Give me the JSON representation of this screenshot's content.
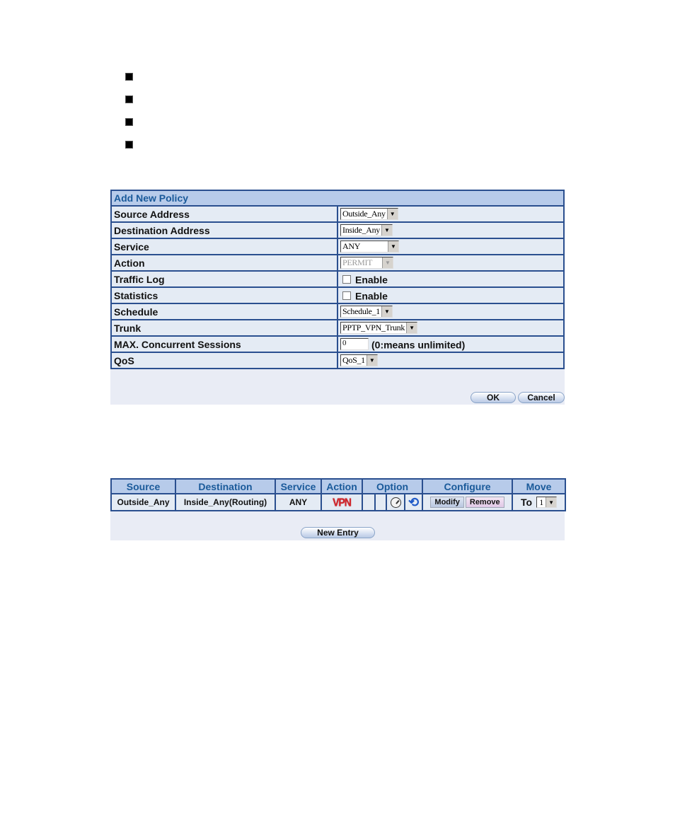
{
  "bullets": {
    "count": 4
  },
  "add_policy": {
    "title": "Add New Policy",
    "rows": [
      {
        "label": "Source Address",
        "type": "select",
        "value": "Outside_Any",
        "disabled": false
      },
      {
        "label": "Destination Address",
        "type": "select",
        "value": "Inside_Any",
        "disabled": false
      },
      {
        "label": "Service",
        "type": "select",
        "value": "ANY",
        "disabled": false
      },
      {
        "label": "Action",
        "type": "select",
        "value": "PERMIT",
        "disabled": true
      },
      {
        "label": "Traffic Log",
        "type": "checkbox",
        "checkbox_label": "Enable",
        "checked": false
      },
      {
        "label": "Statistics",
        "type": "checkbox",
        "checkbox_label": "Enable",
        "checked": false
      },
      {
        "label": "Schedule",
        "type": "select",
        "value": "Schedule_1",
        "disabled": false
      },
      {
        "label": "Trunk",
        "type": "select",
        "value": "PPTP_VPN_Trunk",
        "disabled": false
      },
      {
        "label": "MAX. Concurrent Sessions",
        "type": "text",
        "value": "0",
        "hint": "(0:means unlimited)"
      },
      {
        "label": "QoS",
        "type": "select",
        "value": "QoS_1",
        "disabled": false
      }
    ],
    "ok_label": "OK",
    "cancel_label": "Cancel"
  },
  "policy_list": {
    "columns": [
      "Source",
      "Destination",
      "Service",
      "Action",
      "Option",
      "Configure",
      "Move"
    ],
    "rows": [
      {
        "source": "Outside_Any",
        "destination": "Inside_Any(Routing)",
        "service": "ANY",
        "action": "VPN",
        "option_icons": [
          "schedule-clock-icon",
          "qos-loop-icon"
        ],
        "modify_label": "Modify",
        "remove_label": "Remove",
        "move_label": "To",
        "move_value": "1"
      }
    ],
    "new_entry_label": "New Entry"
  },
  "colors": {
    "border": "#2a4f8f",
    "header_bg": "#b7cbea",
    "header_text": "#1a5a9a",
    "row_bg": "#e4ebf4",
    "panel_bg": "#e9ecf5",
    "vpn_red": "#d3242b"
  }
}
